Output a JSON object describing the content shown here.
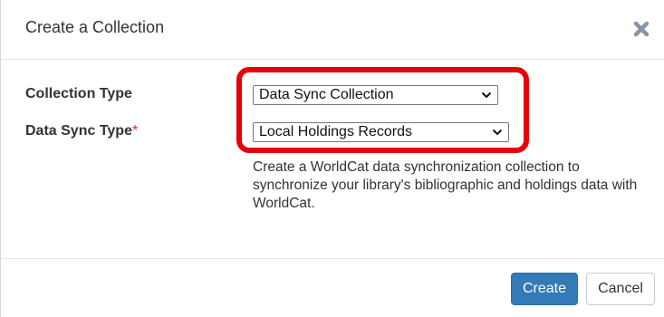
{
  "dialog": {
    "title": "Create a Collection",
    "close_icon": "close-icon"
  },
  "form": {
    "collection_type": {
      "label": "Collection Type",
      "selected": "Data Sync Collection"
    },
    "data_sync_type": {
      "label": "Data Sync Type",
      "required_marker": "*",
      "selected": "Local Holdings Records"
    },
    "help_text": "Create a WorldCat data synchronization collection to synchronize your library's bibliographic and holdings data with WorldCat."
  },
  "footer": {
    "create_label": "Create",
    "cancel_label": "Cancel"
  },
  "colors": {
    "highlight": "#e8000b",
    "primary": "#337ab7",
    "required": "#c9302c"
  }
}
